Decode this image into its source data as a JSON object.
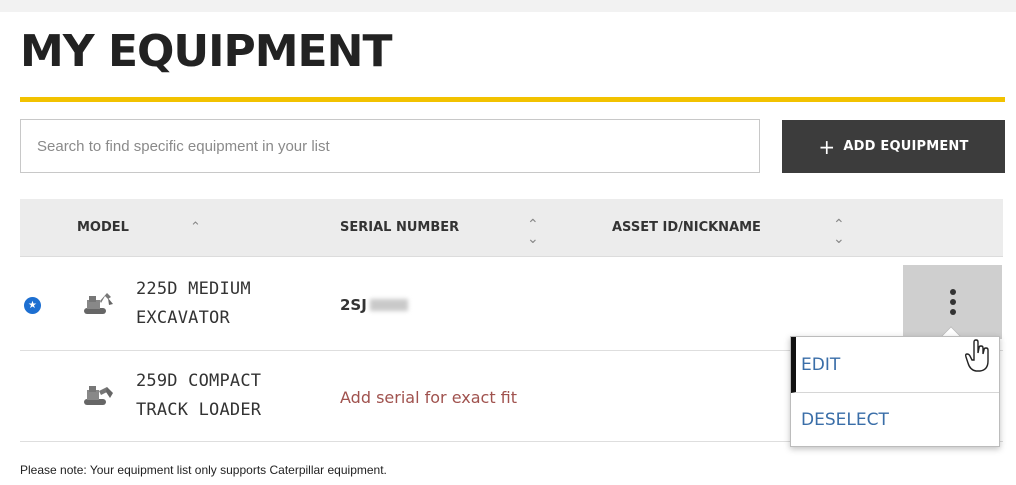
{
  "page": {
    "title": "MY EQUIPMENT"
  },
  "search": {
    "placeholder": "Search to find specific equipment in your list"
  },
  "toolbar": {
    "add_label": "ADD EQUIPMENT",
    "add_icon": "plus-icon"
  },
  "table": {
    "columns": [
      {
        "label": "MODEL",
        "sort": "ascending"
      },
      {
        "label": "SERIAL NUMBER",
        "sort": "unsorted"
      },
      {
        "label": "ASSET ID/NICKNAME",
        "sort": "unsorted"
      }
    ],
    "rows": [
      {
        "model_line1": "225D MEDIUM",
        "model_line2": "EXCAVATOR",
        "serial": "2SJ",
        "serial_redacted": true,
        "favorite": true,
        "icon": "excavator-icon"
      },
      {
        "model_line1": "259D COMPACT",
        "model_line2": "TRACK LOADER",
        "serial": "",
        "serial_prompt": "Add serial for exact fit",
        "favorite": false,
        "icon": "track-loader-icon"
      }
    ]
  },
  "context_menu": {
    "items": [
      {
        "label": "EDIT"
      },
      {
        "label": "DESELECT"
      }
    ]
  },
  "footer": {
    "note": "Please note: Your equipment list only supports Caterpillar equipment."
  },
  "colors": {
    "accent_yellow": "#f2c200",
    "button_dark": "#3c3c3c",
    "favorite_blue": "#1d6fd1",
    "menu_link": "#3a6ea8",
    "prompt_red": "#a0524e"
  }
}
